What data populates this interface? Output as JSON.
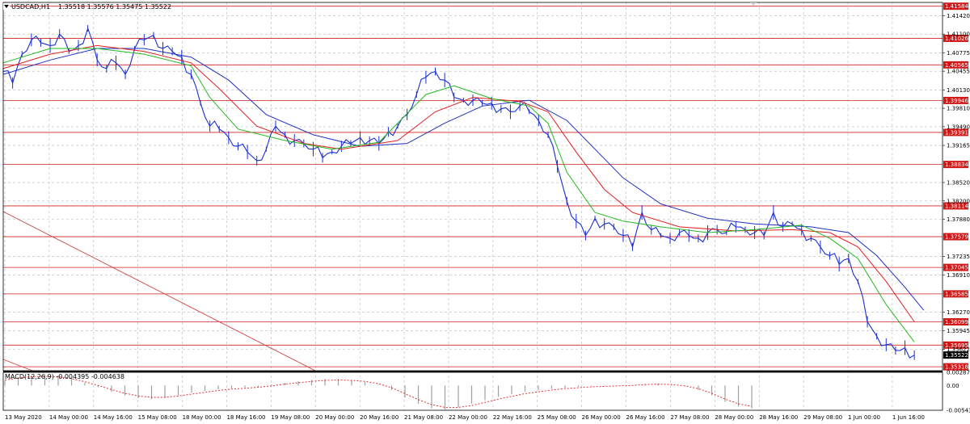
{
  "header": {
    "symbol": "USDCAD,H1",
    "ohlc": "1.35518 1.35576 1.35475 1.35522"
  },
  "macd": {
    "label": "MACD(12,26,9) -0.004395 -0.004638",
    "ticks": [
      "0.002876",
      "0.00",
      "-0.005433"
    ]
  },
  "colors": {
    "background": "#ffffff",
    "grid": "#b8b8b8",
    "price": "#1a30d6",
    "ma_fast": "#22b822",
    "ma_mid": "#e02020",
    "ma_slow": "#2030c0",
    "level_line": "#d02020",
    "level_label": "#d01818",
    "trend_line": "#d04040",
    "current_label": "#000000"
  },
  "chart_data": {
    "type": "line",
    "ylim": [
      1.3525,
      1.4165
    ],
    "price_ticks": [
      "1.41420",
      "1.41100",
      "1.40775",
      "1.40455",
      "1.40130",
      "1.39810",
      "1.39490",
      "1.39165",
      "1.38520",
      "1.38200",
      "1.37880",
      "1.37235",
      "1.36910",
      "1.36270",
      "1.35945",
      "1.35622"
    ],
    "levels": [
      "1.41584",
      "1.41026",
      "1.40565",
      "1.39946",
      "1.39391",
      "1.38834",
      "1.38114",
      "1.37579",
      "1.37045",
      "1.36585",
      "1.36099",
      "1.35695",
      "1.35318"
    ],
    "current_price": "1.35522",
    "time_labels": [
      "13 May 2020",
      "14 May 00:00",
      "14 May 16:00",
      "15 May 08:00",
      "18 May 00:00",
      "18 May 16:00",
      "19 May 08:00",
      "20 May 00:00",
      "20 May 16:00",
      "21 May 08:00",
      "22 May 00:00",
      "22 May 16:00",
      "25 May 08:00",
      "26 May 00:00",
      "26 May 16:00",
      "27 May 08:00",
      "28 May 00:00",
      "28 May 16:00",
      "29 May 08:00",
      "1 Jun 00:00",
      "1 Jun 16:00"
    ],
    "price_path": [
      [
        0,
        1.4045
      ],
      [
        1,
        1.4025
      ],
      [
        2,
        1.4075
      ],
      [
        3,
        1.41
      ],
      [
        4,
        1.4095
      ],
      [
        5,
        1.409
      ],
      [
        6,
        1.411
      ],
      [
        7,
        1.408
      ],
      [
        8,
        1.409
      ],
      [
        9,
        1.412
      ],
      [
        10,
        1.4065
      ],
      [
        11,
        1.405
      ],
      [
        12,
        1.406
      ],
      [
        13,
        1.404
      ],
      [
        14,
        1.4085
      ],
      [
        15,
        1.41
      ],
      [
        16,
        1.4108
      ],
      [
        17,
        1.4085
      ],
      [
        18,
        1.408
      ],
      [
        19,
        1.407
      ],
      [
        20,
        1.404
      ],
      [
        21,
        1.399
      ],
      [
        22,
        1.395
      ],
      [
        23,
        1.3945
      ],
      [
        24,
        1.393
      ],
      [
        25,
        1.3915
      ],
      [
        26,
        1.3905
      ],
      [
        27,
        1.389
      ],
      [
        28,
        1.391
      ],
      [
        29,
        1.395
      ],
      [
        30,
        1.3935
      ],
      [
        31,
        1.3925
      ],
      [
        32,
        1.392
      ],
      [
        33,
        1.391
      ],
      [
        34,
        1.3895
      ],
      [
        35,
        1.3905
      ],
      [
        36,
        1.3915
      ],
      [
        37,
        1.392
      ],
      [
        38,
        1.393
      ],
      [
        39,
        1.3925
      ],
      [
        40,
        1.392
      ],
      [
        41,
        1.394
      ],
      [
        42,
        1.395
      ],
      [
        43,
        1.397
      ],
      [
        44,
        1.4005
      ],
      [
        45,
        1.4035
      ],
      [
        46,
        1.4045
      ],
      [
        47,
        1.403
      ],
      [
        48,
        1.4
      ],
      [
        49,
        1.3995
      ],
      [
        50,
        1.3995
      ],
      [
        51,
        1.399
      ],
      [
        52,
        1.399
      ],
      [
        53,
        1.398
      ],
      [
        54,
        1.3975
      ],
      [
        55,
        1.3985
      ],
      [
        56,
        1.3975
      ],
      [
        57,
        1.396
      ],
      [
        58,
        1.3935
      ],
      [
        59,
        1.388
      ],
      [
        60,
        1.382
      ],
      [
        61,
        1.3785
      ],
      [
        62,
        1.376
      ],
      [
        63,
        1.379
      ],
      [
        64,
        1.378
      ],
      [
        65,
        1.3775
      ],
      [
        66,
        1.376
      ],
      [
        67,
        1.374
      ],
      [
        68,
        1.38
      ],
      [
        69,
        1.377
      ],
      [
        70,
        1.376
      ],
      [
        71,
        1.3755
      ],
      [
        72,
        1.3765
      ],
      [
        73,
        1.376
      ],
      [
        74,
        1.3755
      ],
      [
        75,
        1.3765
      ],
      [
        76,
        1.377
      ],
      [
        77,
        1.3765
      ],
      [
        78,
        1.3775
      ],
      [
        79,
        1.377
      ],
      [
        80,
        1.3765
      ],
      [
        81,
        1.376
      ],
      [
        82,
        1.38
      ],
      [
        83,
        1.3775
      ],
      [
        84,
        1.378
      ],
      [
        85,
        1.377
      ],
      [
        86,
        1.3755
      ],
      [
        87,
        1.374
      ],
      [
        88,
        1.3725
      ],
      [
        89,
        1.371
      ],
      [
        90,
        1.372
      ],
      [
        91,
        1.368
      ],
      [
        92,
        1.361
      ],
      [
        93,
        1.3585
      ],
      [
        94,
        1.357
      ],
      [
        95,
        1.356
      ],
      [
        96,
        1.3565
      ],
      [
        97,
        1.3552
      ]
    ],
    "ma_fast": [
      [
        0,
        1.406
      ],
      [
        5,
        1.4085
      ],
      [
        10,
        1.4085
      ],
      [
        15,
        1.4075
      ],
      [
        20,
        1.4055
      ],
      [
        22,
        1.4
      ],
      [
        25,
        1.3945
      ],
      [
        30,
        1.3925
      ],
      [
        35,
        1.391
      ],
      [
        40,
        1.3922
      ],
      [
        45,
        1.4005
      ],
      [
        48,
        1.402
      ],
      [
        52,
        1.3998
      ],
      [
        56,
        1.3985
      ],
      [
        58,
        1.3955
      ],
      [
        60,
        1.387
      ],
      [
        63,
        1.38
      ],
      [
        66,
        1.3785
      ],
      [
        70,
        1.3775
      ],
      [
        75,
        1.3765
      ],
      [
        80,
        1.377
      ],
      [
        85,
        1.3778
      ],
      [
        88,
        1.3755
      ],
      [
        91,
        1.372
      ],
      [
        94,
        1.364
      ],
      [
        97,
        1.3575
      ]
    ],
    "ma_mid": [
      [
        0,
        1.405
      ],
      [
        5,
        1.4075
      ],
      [
        10,
        1.409
      ],
      [
        15,
        1.408
      ],
      [
        20,
        1.406
      ],
      [
        23,
        1.4015
      ],
      [
        27,
        1.395
      ],
      [
        32,
        1.392
      ],
      [
        36,
        1.391
      ],
      [
        42,
        1.3925
      ],
      [
        46,
        1.3975
      ],
      [
        50,
        1.4
      ],
      [
        55,
        1.3993
      ],
      [
        58,
        1.3975
      ],
      [
        61,
        1.3905
      ],
      [
        64,
        1.384
      ],
      [
        67,
        1.38
      ],
      [
        72,
        1.3775
      ],
      [
        78,
        1.3768
      ],
      [
        84,
        1.377
      ],
      [
        88,
        1.3765
      ],
      [
        91,
        1.374
      ],
      [
        94,
        1.368
      ],
      [
        97,
        1.361
      ]
    ],
    "ma_slow": [
      [
        0,
        1.404
      ],
      [
        5,
        1.4065
      ],
      [
        10,
        1.4085
      ],
      [
        15,
        1.4085
      ],
      [
        20,
        1.407
      ],
      [
        24,
        1.403
      ],
      [
        28,
        1.397
      ],
      [
        33,
        1.3935
      ],
      [
        38,
        1.3915
      ],
      [
        43,
        1.392
      ],
      [
        47,
        1.3955
      ],
      [
        51,
        1.3985
      ],
      [
        56,
        1.3995
      ],
      [
        60,
        1.396
      ],
      [
        63,
        1.391
      ],
      [
        66,
        1.386
      ],
      [
        70,
        1.3815
      ],
      [
        75,
        1.379
      ],
      [
        80,
        1.378
      ],
      [
        86,
        1.3775
      ],
      [
        90,
        1.3765
      ],
      [
        93,
        1.3725
      ],
      [
        96,
        1.367
      ],
      [
        98,
        1.363
      ]
    ],
    "macd_hist": [
      0.001,
      0.0018,
      0.0022,
      0.0024,
      0.0022,
      0.0015,
      0.0006,
      -0.0004,
      -0.0014,
      -0.0022,
      -0.0028,
      -0.003,
      -0.0027,
      -0.0022,
      -0.0016,
      -0.0012,
      -0.0008,
      -0.0006,
      -0.0004,
      -0.0003,
      0.0002,
      0.0006,
      0.0009,
      0.0012,
      0.0014,
      0.0014,
      0.0012,
      0.0008,
      0.0002,
      -0.001,
      -0.0026,
      -0.004,
      -0.005,
      -0.0053,
      -0.0048,
      -0.004,
      -0.0032,
      -0.0025,
      -0.0019,
      -0.0014,
      -0.001,
      -0.0007,
      -0.0005,
      -0.0003,
      -0.0002,
      -0.0001,
      0.0,
      0.0001,
      0.0003,
      0.0004,
      0.0002,
      -0.0002,
      -0.001,
      -0.0022,
      -0.0036,
      -0.0046,
      -0.005
    ],
    "macd_signal": [
      0.0012,
      0.0016,
      0.0019,
      0.002,
      0.0019,
      0.0015,
      0.0008,
      0.0,
      -0.0009,
      -0.0017,
      -0.0023,
      -0.0026,
      -0.0026,
      -0.0023,
      -0.0019,
      -0.0015,
      -0.0011,
      -0.0008,
      -0.0006,
      -0.0004,
      -0.0001,
      0.0003,
      0.0006,
      0.0009,
      0.0011,
      0.0012,
      0.0011,
      0.0009,
      0.0004,
      -0.0005,
      -0.0018,
      -0.0031,
      -0.0042,
      -0.0048,
      -0.0048,
      -0.0044,
      -0.0037,
      -0.003,
      -0.0024,
      -0.0018,
      -0.0014,
      -0.001,
      -0.0007,
      -0.0005,
      -0.0003,
      -0.0002,
      -0.0001,
      0.0,
      0.0002,
      0.0003,
      0.0002,
      -0.0001,
      -0.0007,
      -0.0017,
      -0.003,
      -0.004,
      -0.0046
    ]
  }
}
